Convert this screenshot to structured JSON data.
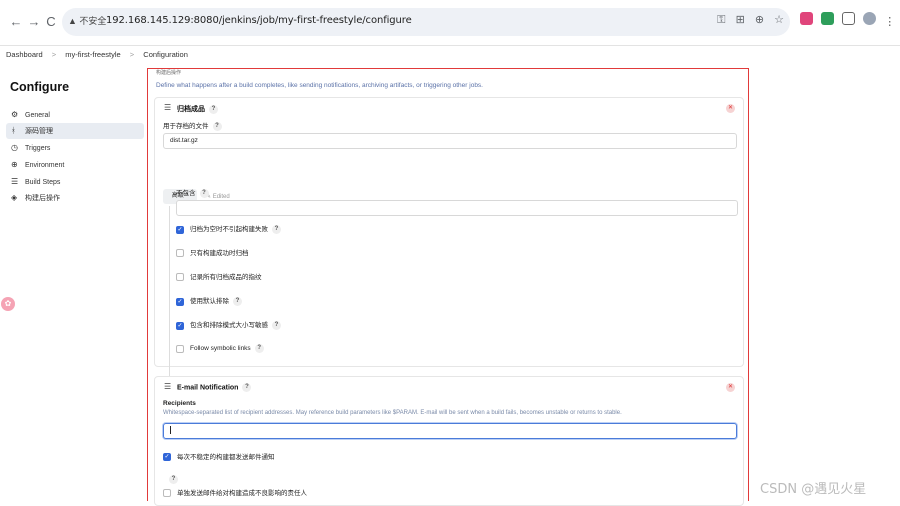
{
  "browser": {
    "back": "←",
    "forward": "→",
    "reload": "C",
    "insecure_label": "▲ 不安全",
    "url": "192.168.145.129:8080/jenkins/job/my-first-freestyle/configure",
    "url_icons": [
      "⚿",
      "⊞",
      "⊕",
      "☆"
    ]
  },
  "breadcrumb": {
    "items": [
      "Dashboard",
      "my-first-freestyle",
      "Configuration"
    ],
    "separator": ">"
  },
  "sidebar": {
    "title": "Configure",
    "items": [
      {
        "icon": "⚙",
        "label": "General"
      },
      {
        "icon": "ᚼ",
        "label": "源码管理"
      },
      {
        "icon": "◷",
        "label": "Triggers"
      },
      {
        "icon": "⊕",
        "label": "Environment"
      },
      {
        "icon": "☰",
        "label": "Build Steps"
      },
      {
        "icon": "◈",
        "label": "构建后操作"
      }
    ]
  },
  "post_build": {
    "section_header": "构建后操作",
    "description": "Define what happens after a build completes, like sending notifications, archiving artifacts, or triggering other jobs."
  },
  "archive_card": {
    "title": "归档成品",
    "files_label": "用于存档的文件",
    "files_value": "dist.tar.gz",
    "advanced_label": "高级 ^",
    "edited_label": "✎ Edited",
    "excludes_label": "不包含",
    "excludes_value": "",
    "options": [
      {
        "label": "归档为空时不引起构建失败",
        "checked": true,
        "help": true
      },
      {
        "label": "只有构建成功时归档",
        "checked": false,
        "help": false
      },
      {
        "label": "记录所有归档成品的指纹",
        "checked": false,
        "help": false
      },
      {
        "label": "使用默认排除",
        "checked": true,
        "help": true
      },
      {
        "label": "包含和排除模式大小写敏感",
        "checked": true,
        "help": true
      },
      {
        "label": "Follow symbolic links",
        "checked": false,
        "help": true
      }
    ]
  },
  "email_card": {
    "title": "E-mail Notification",
    "recipients_label": "Recipients",
    "recipients_desc": "Whitespace-separated list of recipient addresses. May reference build parameters like $PARAM. E-mail will be sent when a build fails, becomes unstable or returns to stable.",
    "recipients_value": "",
    "options": [
      {
        "label": "每次不稳定的构建都发送邮件通知",
        "checked": true
      },
      {
        "label": "单独发送邮件给对构建造成不良影响的责任人",
        "checked": false
      }
    ]
  },
  "help_mark": "?",
  "watermark": "CSDN @遇见火星"
}
